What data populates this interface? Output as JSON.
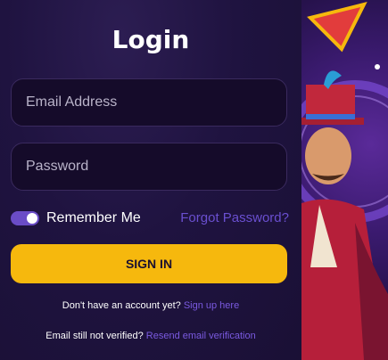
{
  "login": {
    "title": "Login",
    "email_placeholder": "Email Address",
    "password_placeholder": "Password",
    "remember_label": "Remember Me",
    "remember_checked": true,
    "forgot_label": "Forgot Password?",
    "signin_label": "SIGN IN",
    "no_account_text": "Don't have an account yet?",
    "signup_link": "Sign up here",
    "not_verified_text": "Email still not verified?",
    "resend_link": "Resend email verification"
  },
  "colors": {
    "accent": "#f6b80d",
    "link": "#6a4fd0",
    "toggle": "#6a4cc7"
  },
  "art": {
    "description_icon": "casino-character-icon"
  }
}
